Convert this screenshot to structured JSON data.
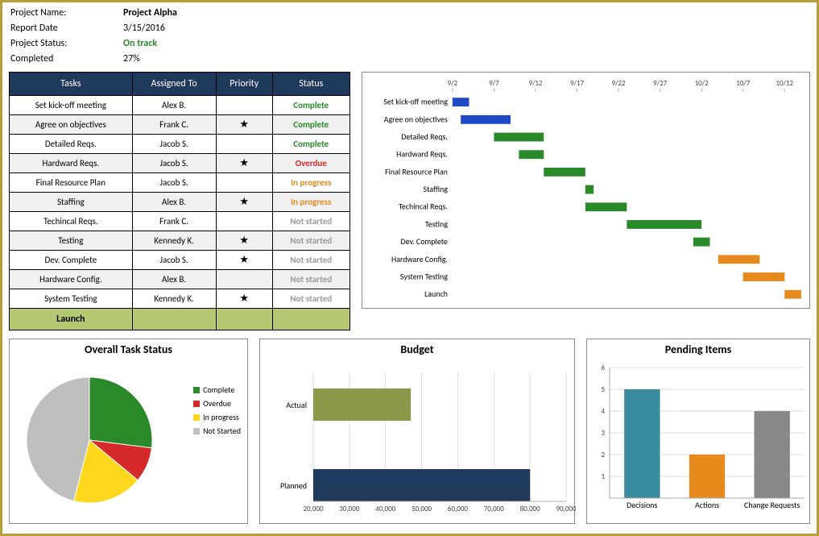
{
  "header": {
    "project_name_lbl": "Project Name:",
    "project_name": "Project Alpha",
    "report_date_lbl": "Report Date",
    "report_date": "3/15/2016",
    "status_lbl": "Project Status:",
    "status": "On track",
    "completed_lbl": "Completed",
    "completed": "27%"
  },
  "task_table": {
    "headers": [
      "Tasks",
      "Assigned To",
      "Priority",
      "Status"
    ],
    "rows": [
      {
        "task": "Set kick-off meeting",
        "assigned": "Alex B.",
        "priority": "",
        "status": "Complete",
        "status_class": "st-complete"
      },
      {
        "task": "Agree on objectives",
        "assigned": "Frank C.",
        "priority": "★",
        "status": "Complete",
        "status_class": "st-complete"
      },
      {
        "task": "Detailed Reqs.",
        "assigned": "Jacob S.",
        "priority": "",
        "status": "Complete",
        "status_class": "st-complete"
      },
      {
        "task": "Hardward Reqs.",
        "assigned": "Jacob S.",
        "priority": "★",
        "status": "Overdue",
        "status_class": "st-overdue"
      },
      {
        "task": "Final Resource Plan",
        "assigned": "Jacob S.",
        "priority": "",
        "status": "In progress",
        "status_class": "st-progress"
      },
      {
        "task": "Staffing",
        "assigned": "Alex B.",
        "priority": "★",
        "status": "In progress",
        "status_class": "st-progress"
      },
      {
        "task": "Techincal Reqs.",
        "assigned": "Frank C.",
        "priority": "",
        "status": "Not started",
        "status_class": "st-notstarted"
      },
      {
        "task": "Testing",
        "assigned": "Kennedy K.",
        "priority": "★",
        "status": "Not started",
        "status_class": "st-notstarted"
      },
      {
        "task": "Dev. Complete",
        "assigned": "Jacob S.",
        "priority": "★",
        "status": "Not started",
        "status_class": "st-notstarted"
      },
      {
        "task": "Hardware Config.",
        "assigned": "Alex B.",
        "priority": "",
        "status": "Not started",
        "status_class": "st-notstarted"
      },
      {
        "task": "System Testing",
        "assigned": "Kennedy K.",
        "priority": "★",
        "status": "Not started",
        "status_class": "st-notstarted"
      }
    ],
    "launch_label": "Launch"
  },
  "chart_data": [
    {
      "id": "gantt",
      "type": "bar",
      "title": "",
      "x_ticks": [
        "9/2",
        "9/7",
        "9/12",
        "9/17",
        "9/22",
        "9/27",
        "10/2",
        "10/7",
        "10/12"
      ],
      "x_domain": [
        0,
        42
      ],
      "tasks": [
        {
          "name": "Set kick-off meeting",
          "start": 0,
          "dur": 2,
          "color": "#1f49c4"
        },
        {
          "name": "Agree on objectives",
          "start": 1,
          "dur": 6,
          "color": "#1f49c4"
        },
        {
          "name": "Detailed Reqs.",
          "start": 5,
          "dur": 6,
          "color": "#2a8a2a"
        },
        {
          "name": "Hardward Reqs.",
          "start": 8,
          "dur": 3,
          "color": "#2a8a2a"
        },
        {
          "name": "Final Resource Plan",
          "start": 11,
          "dur": 5,
          "color": "#2a8a2a"
        },
        {
          "name": "Staffing",
          "start": 16,
          "dur": 1,
          "color": "#2a8a2a"
        },
        {
          "name": "Techincal Reqs.",
          "start": 16,
          "dur": 5,
          "color": "#2a8a2a"
        },
        {
          "name": "Testing",
          "start": 21,
          "dur": 9,
          "color": "#2a8a2a"
        },
        {
          "name": "Dev. Complete",
          "start": 29,
          "dur": 2,
          "color": "#2a8a2a"
        },
        {
          "name": "Hardware Config.",
          "start": 32,
          "dur": 5,
          "color": "#e68a1e"
        },
        {
          "name": "System Testing",
          "start": 35,
          "dur": 5,
          "color": "#e68a1e"
        },
        {
          "name": "Launch",
          "start": 40,
          "dur": 2,
          "color": "#e68a1e"
        }
      ]
    },
    {
      "id": "pie",
      "type": "pie",
      "title": "Overall Task Status",
      "slices": [
        {
          "label": "Complete",
          "value": 27,
          "color": "#2a8a2a"
        },
        {
          "label": "Overdue",
          "value": 9,
          "color": "#d62a2a"
        },
        {
          "label": "In progress",
          "value": 18,
          "color": "#ffd81e"
        },
        {
          "label": "Not Started",
          "value": 46,
          "color": "#bfbfbf"
        }
      ]
    },
    {
      "id": "budget",
      "type": "bar",
      "orientation": "horizontal",
      "title": "Budget",
      "categories": [
        "Actual",
        "Planned"
      ],
      "values": [
        47000,
        80000
      ],
      "colors": [
        "#8a9a4a",
        "#1f3a5c"
      ],
      "x_ticks": [
        20000,
        30000,
        40000,
        50000,
        60000,
        70000,
        80000,
        90000
      ],
      "xlim": [
        20000,
        90000
      ]
    },
    {
      "id": "pending",
      "type": "bar",
      "title": "Pending Items",
      "categories": [
        "Decisions",
        "Actions",
        "Change Requests"
      ],
      "values": [
        5,
        2,
        4
      ],
      "colors": [
        "#3a8aa0",
        "#e68a1e",
        "#888"
      ],
      "y_ticks": [
        1,
        2,
        3,
        4,
        5,
        6
      ],
      "ylim": [
        0,
        6
      ]
    }
  ]
}
